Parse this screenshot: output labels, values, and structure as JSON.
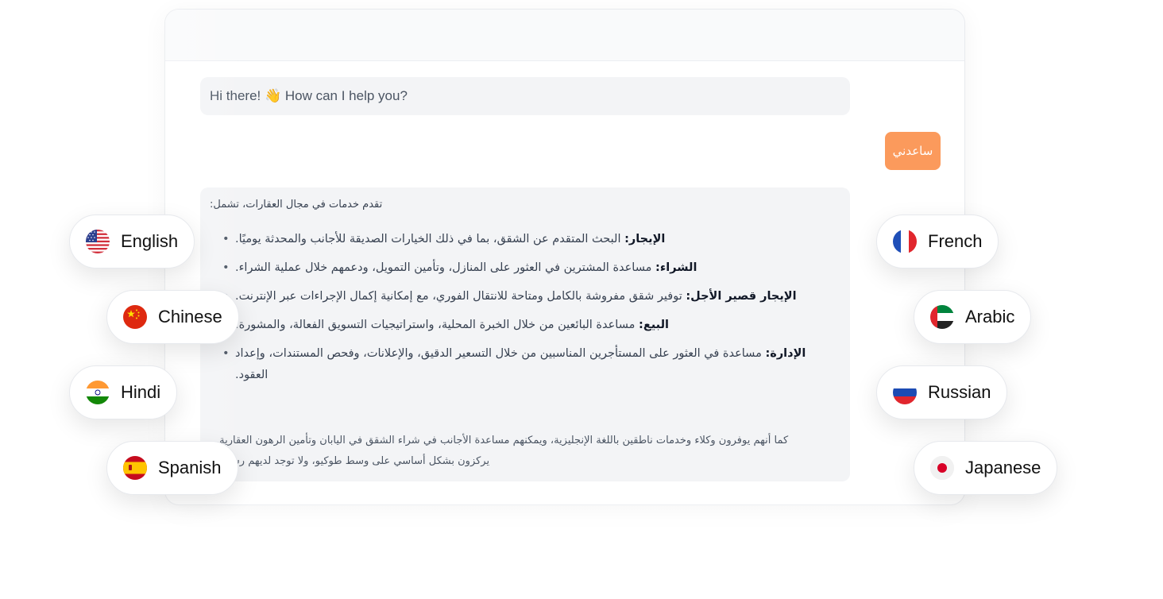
{
  "chat": {
    "greeting": "Hi there! 👋 How can I help you?",
    "user_message": "ساعدني",
    "answer": {
      "intro": "تقدم خدمات في مجال العقارات، تشمل:",
      "services": [
        {
          "label": "الإيجار:",
          "text": "البحث المتقدم عن الشقق، بما في ذلك الخيارات الصديقة للأجانب والمحدثة يوميًا."
        },
        {
          "label": "الشراء:",
          "text": "مساعدة المشترين في العثور على المنازل، وتأمين التمويل، ودعمهم خلال عملية الشراء."
        },
        {
          "label": "الإيجار قصير الأجل:",
          "text": "توفير شقق مفروشة بالكامل ومتاحة للانتقال الفوري، مع إمكانية إكمال الإجراءات عبر الإنترنت."
        },
        {
          "label": "البيع:",
          "text": "مساعدة البائعين من خلال الخبرة المحلية، واستراتيجيات التسويق الفعالة، والمشورة."
        },
        {
          "label": "الإدارة:",
          "text": "مساعدة في العثور على المستأجرين المناسبين من خلال التسعير الدقيق، والإعلانات، وفحص المستندات، وإعداد العقود."
        }
      ],
      "footer_line1": "كما أنهم يوفرون وكلاء وخدمات ناطقين باللغة الإنجليزية، ويمكنهم مساعدة الأجانب في شراء الشقق في اليابان وتأمين الرهون العقارية.",
      "footer_line2": "يركزون بشكل أساسي على وسط طوكيو، ولا توجد لديهم رسوم."
    }
  },
  "languages": {
    "english": {
      "label": "English",
      "icon": "us-flag-icon"
    },
    "chinese": {
      "label": "Chinese",
      "icon": "china-flag-icon"
    },
    "hindi": {
      "label": "Hindi",
      "icon": "india-flag-icon"
    },
    "spanish": {
      "label": "Spanish",
      "icon": "spain-flag-icon"
    },
    "french": {
      "label": "French",
      "icon": "france-flag-icon"
    },
    "arabic": {
      "label": "Arabic",
      "icon": "uae-flag-icon"
    },
    "russian": {
      "label": "Russian",
      "icon": "russia-flag-icon"
    },
    "japanese": {
      "label": "Japanese",
      "icon": "japan-flag-icon"
    }
  },
  "colors": {
    "user_bubble": "#fb9a5c",
    "bot_bubble": "#f3f4f6"
  }
}
